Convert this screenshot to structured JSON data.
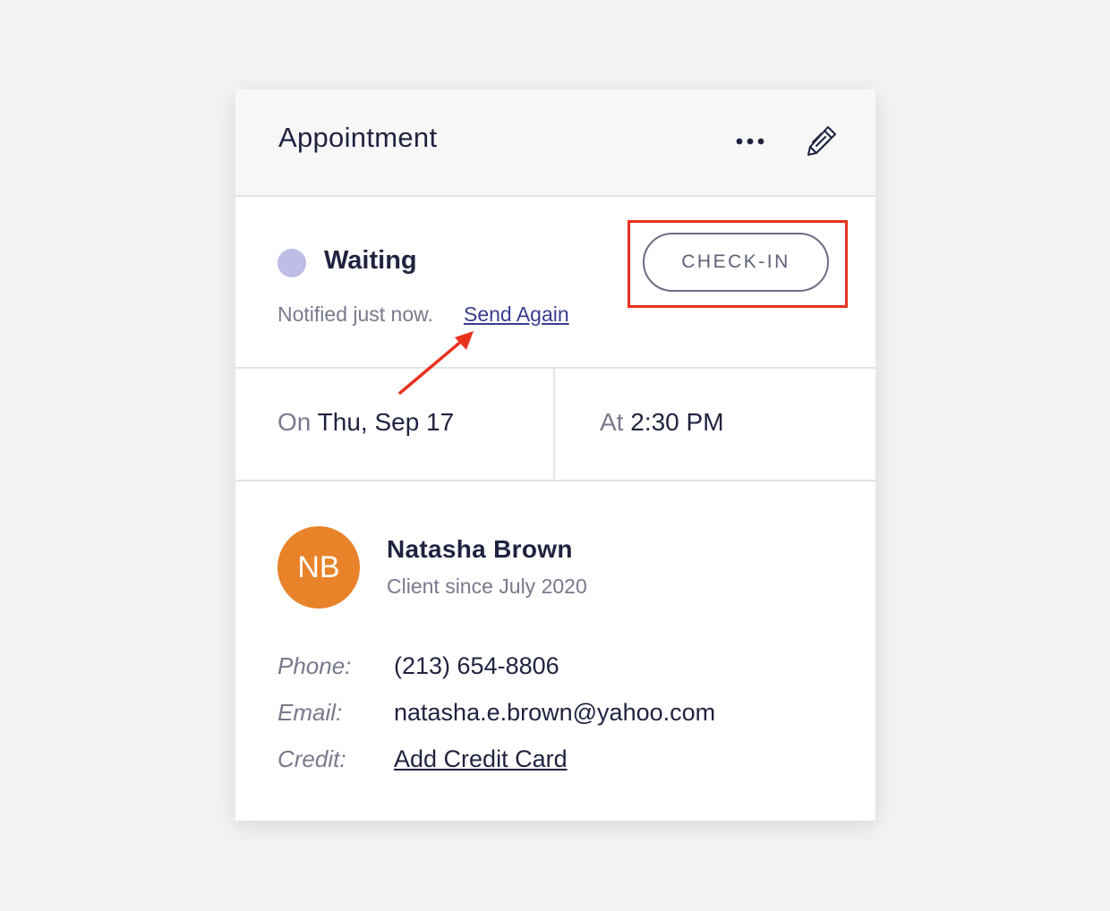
{
  "header": {
    "title": "Appointment",
    "more_icon": "ellipsis-icon",
    "edit_icon": "pencil-icon"
  },
  "status": {
    "label": "Waiting",
    "dot_color": "#bdbde6",
    "notified_text": "Notified just now.",
    "send_again_label": "Send Again",
    "checkin_label": "CHECK-IN",
    "highlight_color": "#e8321e"
  },
  "schedule": {
    "date_prefix": "On",
    "date_value": "Thu, Sep 17",
    "time_prefix": "At",
    "time_value": "2:30 PM"
  },
  "client": {
    "initials": "NB",
    "avatar_color": "#e8832a",
    "name": "Natasha Brown",
    "since": "Client since July 2020",
    "phone_label": "Phone:",
    "phone_value": "(213) 654-8806",
    "email_label": "Email:",
    "email_value": "natasha.e.brown@yahoo.com",
    "credit_label": "Credit:",
    "credit_value": "Add Credit Card"
  }
}
